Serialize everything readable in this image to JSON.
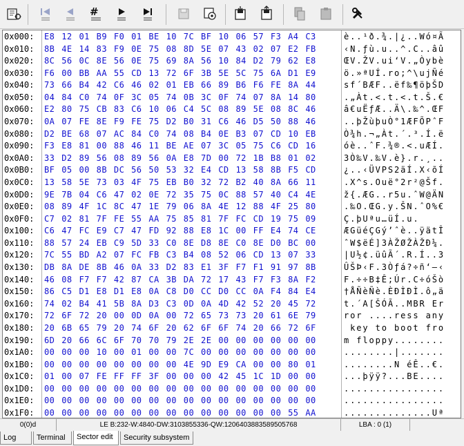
{
  "toolbar": {
    "icons": [
      "open-device-icon",
      "skip-first-icon",
      "step-back-icon",
      "goto-sector-icon",
      "step-forward-icon",
      "skip-last-icon",
      "save-disk-icon",
      "save-config-icon",
      "load-sector-icon",
      "save-sector-icon",
      "copy-icon",
      "paste-icon",
      "tools-icon"
    ]
  },
  "hex": {
    "rows": [
      {
        "addr": "0x000:",
        "bytes": "E8 12 01 B9 F0 01 BE 10 7C BF 10 06 57 F3 A4 C3",
        "ascii": "è..¹ð.¾.|¿..Wó¤Ã"
      },
      {
        "addr": "0x010:",
        "bytes": "8B 4E 14 83 F9 0E 75 08 8D 5E 07 43 02 07 E2 FB",
        "ascii": "‹N.ƒù.u..^.C..âû"
      },
      {
        "addr": "0x020:",
        "bytes": "8C 56 0C 8E 56 0E 75 69 8A 56 10 84 D2 79 62 E8",
        "ascii": "ŒV.ŽV.ui‘V.„Òybè"
      },
      {
        "addr": "0x030:",
        "bytes": "F6 00 BB AA 55 CD 13 72 6F 3B 5E 5C 75 6A D1 E9",
        "ascii": "ö.»ªUÍ.ro;^\\ujÑé"
      },
      {
        "addr": "0x040:",
        "bytes": "73 66 B4 42 C6 46 02 01 EB 66 89 B6 F6 FE 8A 44",
        "ascii": "sf´BÆF..ëf‰¶öþŠD"
      },
      {
        "addr": "0x050:",
        "bytes": "04 84 C0 74 0F 3C 05 74 0B 3C 0F 74 07 8A 14 80",
        "ascii": ".„Àt.<.t.<.t.Š.€"
      },
      {
        "addr": "0x060:",
        "bytes": "E2 80 75 CB 83 C6 10 06 C4 5C 08 89 5E 08 8C 46",
        "ascii": "â€uËƒÆ..Ä\\.‰^.ŒF"
      },
      {
        "addr": "0x070:",
        "bytes": "0A 07 FE 8E F9 FE 75 D2 B0 31 C6 46 D5 50 88 46",
        "ascii": "..þŽùþuÒ°1ÆFÕPˆF"
      },
      {
        "addr": "0x080:",
        "bytes": "D2 BE 68 07 AC 84 C0 74 08 B4 0E B3 07 CD 10 EB",
        "ascii": "Ò¾h.¬„Àt.´.³.Í.ë"
      },
      {
        "addr": "0x090:",
        "bytes": "F3 E8 81 00 88 46 11 BE AE 07 3C 05 75 C6 CD 16",
        "ascii": "óè..ˆF.¾®.<.uÆÍ."
      },
      {
        "addr": "0x0A0:",
        "bytes": "33 D2 89 56 08 89 56 0A E8 7D 00 72 1B B8 01 02",
        "ascii": "3Ò‰V.‰V.è}.r.¸.."
      },
      {
        "addr": "0x0B0:",
        "bytes": "BF 05 00 8B DC 56 50 53 32 E4 CD 13 58 8B F5 CD",
        "ascii": "¿..‹ÜVPS2äÍ.X‹õÍ"
      },
      {
        "addr": "0x0C0:",
        "bytes": "13 58 5E 73 03 4F 75 EB B0 32 72 B2 40 8A 66 11",
        "ascii": ".X^s.Ouë°2r²@Šf."
      },
      {
        "addr": "0x0D0:",
        "bytes": "9E 7B 04 C6 47 02 0E 72 35 75 0C 88 57 40 C4 4E",
        "ascii": "ž{.ÆG..r5u.ˆW@ÄN"
      },
      {
        "addr": "0x0E0:",
        "bytes": "08 89 4F 1C 8C 47 1E 79 06 8A 4E 12 88 4F 25 80",
        "ascii": ".‰O.ŒG.y.ŠN.ˆO%€"
      },
      {
        "addr": "0x0F0:",
        "bytes": "C7 02 81 7F FE 55 AA 75 85 81 7F FC CD 19 75 09",
        "ascii": "Ç.þUªu…üÍ.u."
      },
      {
        "addr": "0x100:",
        "bytes": "C6 47 FC E9 C7 47 FD 92 88 E8 1C 00 FF E4 74 CE",
        "ascii": "ÆGüéÇGý’ˆè..ÿätÎ"
      },
      {
        "addr": "0x110:",
        "bytes": "88 57 24 EB C9 5D 33 C0 8E D8 8E C0 8E D0 BC 00",
        "ascii": "ˆW$ëÉ]3ÀŽØŽÀŽÐ¼."
      },
      {
        "addr": "0x120:",
        "bytes": "7C 55 BD A2 07 FC FB C3 B4 08 52 06 CD 13 07 33",
        "ascii": "|U½¢.üûÃ´.R.Í..3"
      },
      {
        "addr": "0x130:",
        "bytes": "DB 8A DE 8B 46 0A 33 D2 83 E1 3F F7 F1 91 97 8B",
        "ascii": "ÛŠÞ‹F.3Òƒá?÷ñ‘—‹"
      },
      {
        "addr": "0x140:",
        "bytes": "46 08 F7 F7 42 87 CA 3B DA 72 17 43 F7 F3 8A F2",
        "ascii": "F.÷÷B‡Ê;Úr.C÷óŠò"
      },
      {
        "addr": "0x150:",
        "bytes": "86 C5 D1 E8 D1 E8 0A C8 D0 CC D0 CC 0A F4 84 E4",
        "ascii": "†ÅÑèÑè.ÈÐÌÐÌ.ô„ä"
      },
      {
        "addr": "0x160:",
        "bytes": "74 02 B4 41 5B 8A D3 C3 0D 0A 4D 42 52 20 45 72",
        "ascii": "t.´A[ŠÓÃ..MBR Er"
      },
      {
        "addr": "0x170:",
        "bytes": "72 6F 72 20 00 0D 0A 00 72 65 73 73 20 61 6E 79",
        "ascii": "ror ....ress any"
      },
      {
        "addr": "0x180:",
        "bytes": "20 6B 65 79 20 74 6F 20 62 6F 6F 74 20 66 72 6F",
        "ascii": " key to boot fro"
      },
      {
        "addr": "0x190:",
        "bytes": "6D 20 66 6C 6F 70 70 79 2E 2E 00 00 00 00 00 00",
        "ascii": "m floppy........"
      },
      {
        "addr": "0x1A0:",
        "bytes": "00 00 00 10 00 01 00 00 7C 00 00 00 00 00 00 00",
        "ascii": "........|......."
      },
      {
        "addr": "0x1B0:",
        "bytes": "00 00 00 00 00 00 00 00 4E 9D E9 CA 00 00 80 01",
        "ascii": "........N éÊ..€."
      },
      {
        "addr": "0x1C0:",
        "bytes": "01 00 07 FE FF FF 3F 00 00 00 42 45 1C 1D 00 00",
        "ascii": "...þÿÿ?...BE...."
      },
      {
        "addr": "0x1D0:",
        "bytes": "00 00 00 00 00 00 00 00 00 00 00 00 00 00 00 00",
        "ascii": "................"
      },
      {
        "addr": "0x1E0:",
        "bytes": "00 00 00 00 00 00 00 00 00 00 00 00 00 00 00 00",
        "ascii": "................"
      },
      {
        "addr": "0x1F0:",
        "bytes": "00 00 00 00 00 00 00 00 00 00 00 00 00 00 55 AA",
        "ascii": "..............Uª"
      }
    ]
  },
  "status": {
    "position": "0(0)d",
    "values": "LE B:232-W:4840-DW:3103855336-QW:12064038835895057​68",
    "lba": "LBA : 0 (1)"
  },
  "tabs": [
    {
      "label": "Log",
      "active": false
    },
    {
      "label": "Terminal",
      "active": false
    },
    {
      "label": "Sector edit",
      "active": true
    },
    {
      "label": "Security subsystem",
      "active": false
    }
  ],
  "colors": {
    "hex_bytes": "#1010d0",
    "background": "#ffffff",
    "chrome": "#f0f0f0"
  }
}
